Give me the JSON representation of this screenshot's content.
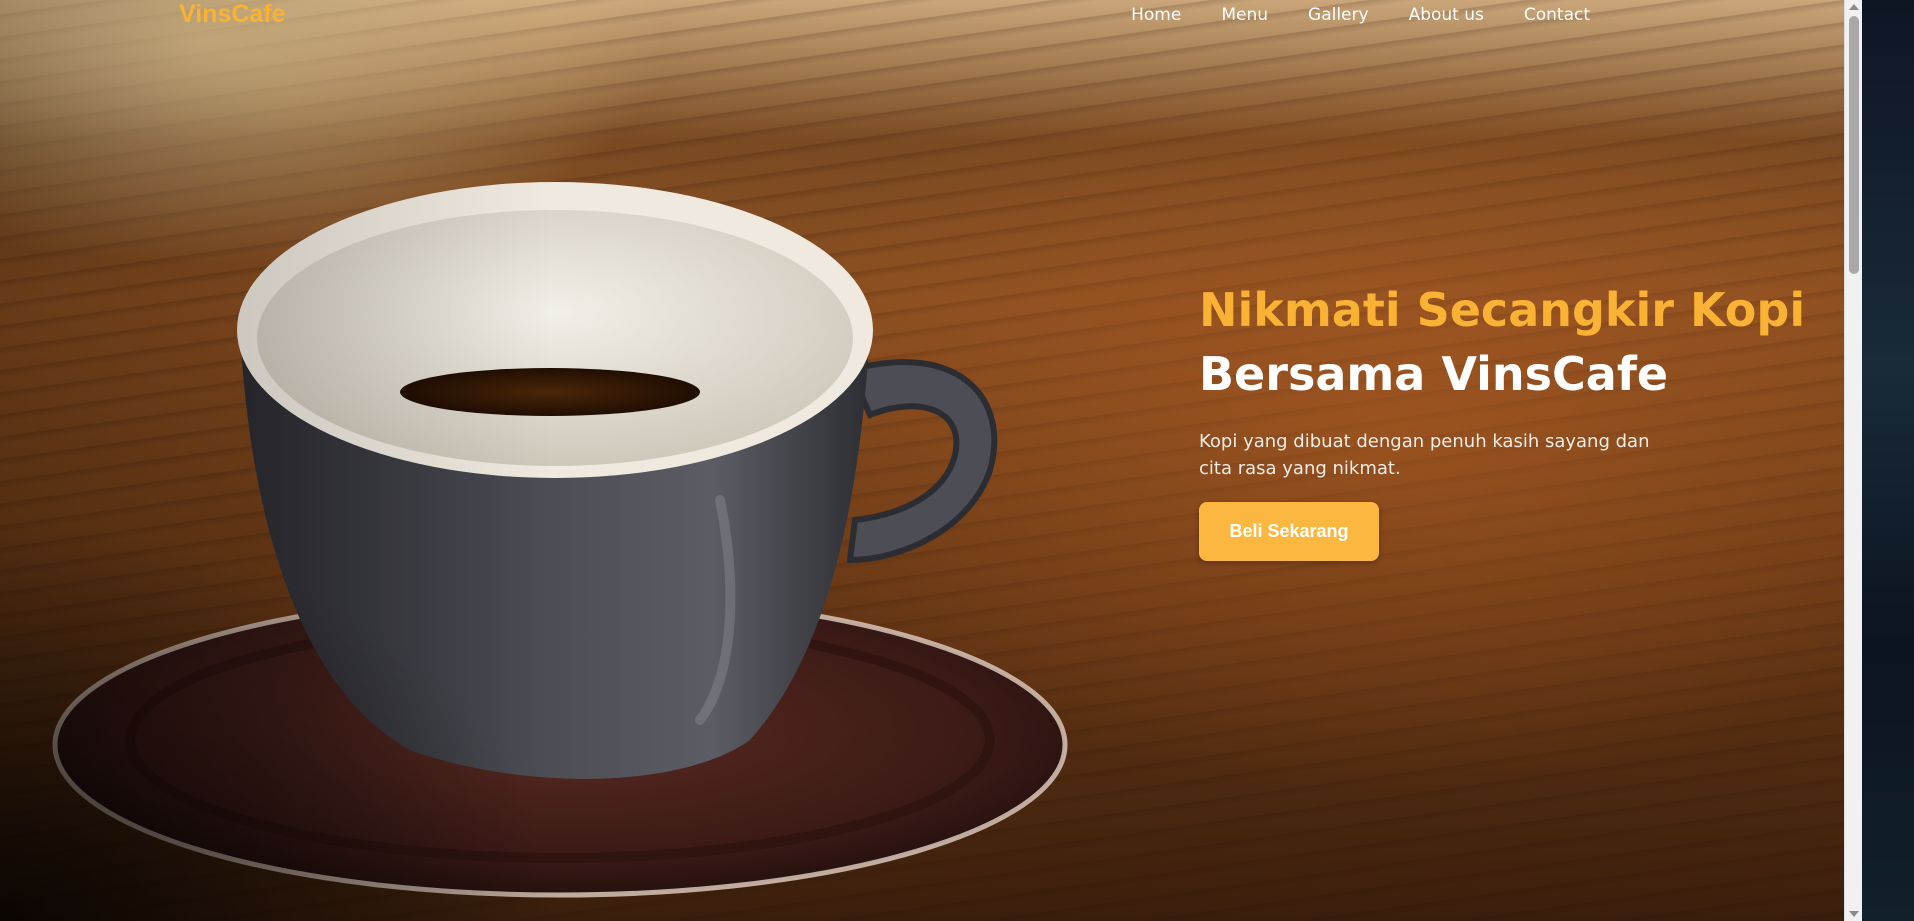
{
  "brand": {
    "logo_text": "VinsCafe",
    "accent_color": "#f9b234"
  },
  "nav": {
    "items": [
      {
        "label": "Home"
      },
      {
        "label": "Menu"
      },
      {
        "label": "Gallery"
      },
      {
        "label": "About us"
      },
      {
        "label": "Contact"
      }
    ]
  },
  "hero": {
    "title_line1": "Nikmati Secangkir Kopi",
    "title_line2": "Bersama VinsCafe",
    "description": "Kopi yang dibuat dengan penuh kasih sayang dan cita rasa yang nikmat.",
    "cta_label": "Beli Sekarang",
    "cta_color": "#fbb73f"
  },
  "background": {
    "image_subject": "coffee-cup-on-wooden-table"
  }
}
